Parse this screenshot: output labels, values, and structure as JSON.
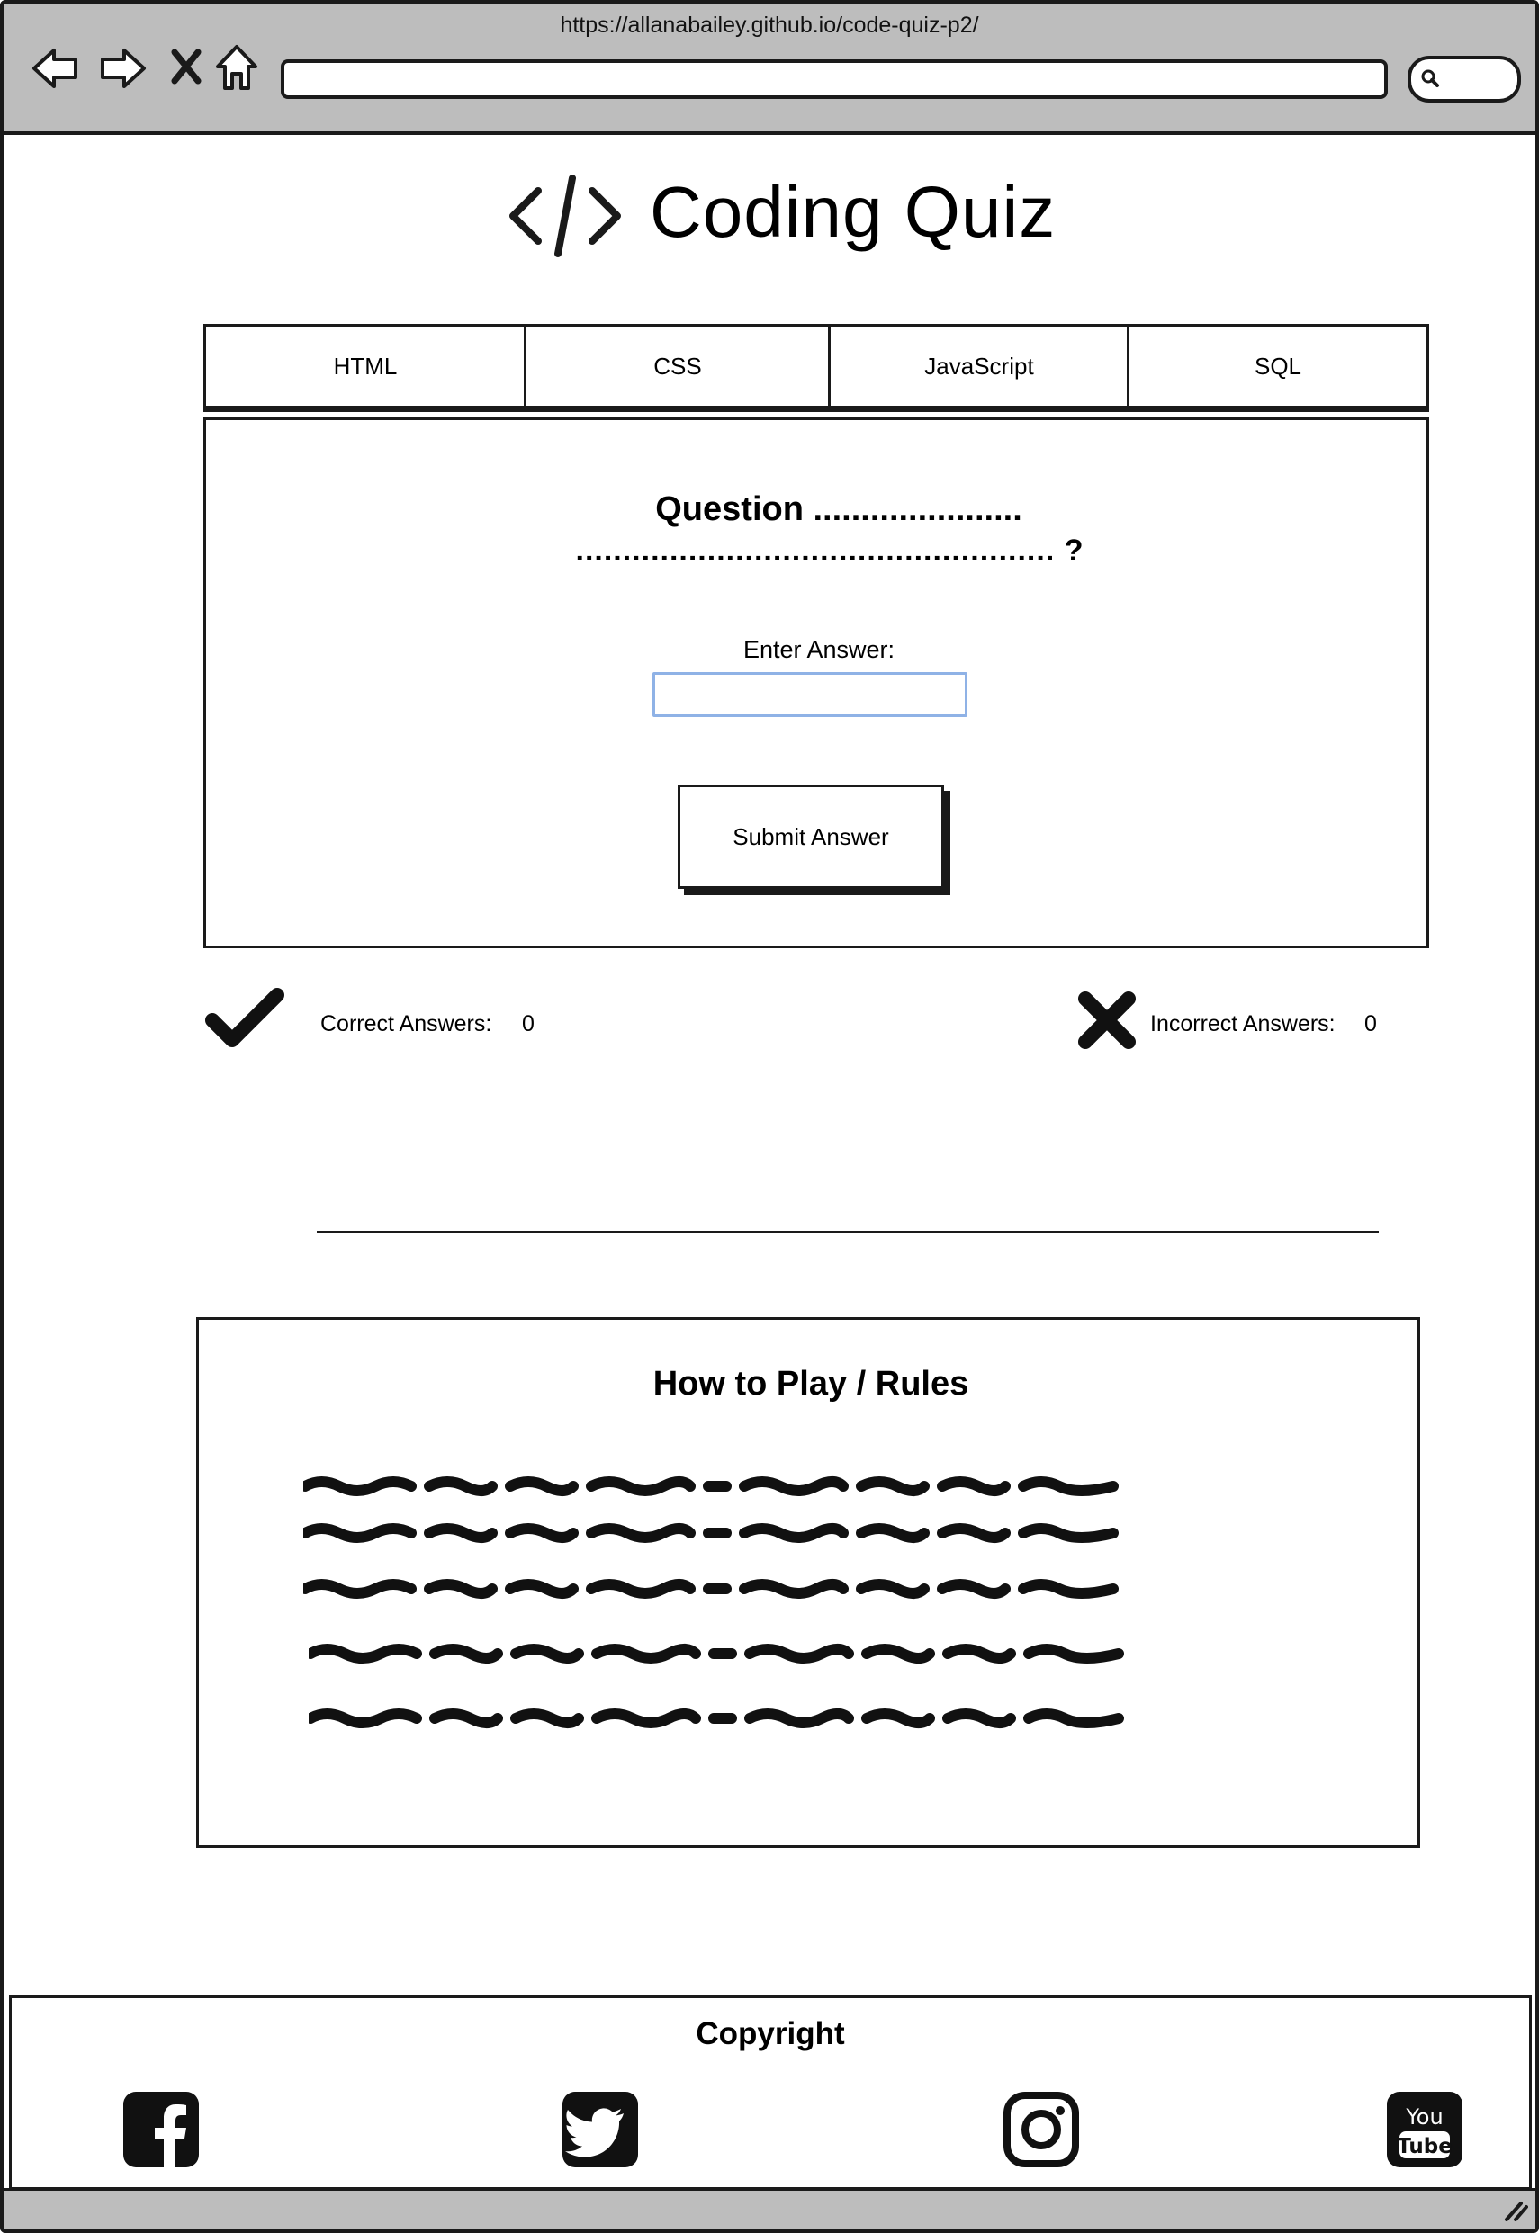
{
  "browser": {
    "url": "https://allanabailey.github.io/code-quiz-p2/",
    "icons": [
      "back-arrow-icon",
      "forward-arrow-icon",
      "close-icon",
      "home-icon",
      "search-icon"
    ]
  },
  "header": {
    "logo_icon": "code-brackets-icon",
    "title": "Coding Quiz"
  },
  "tabs": [
    {
      "label": "HTML"
    },
    {
      "label": "CSS"
    },
    {
      "label": "JavaScript"
    },
    {
      "label": "SQL"
    }
  ],
  "quiz": {
    "question_line1": "Question ......................",
    "question_line2": "................................................... ?",
    "answer_label": "Enter Answer:",
    "answer_value": "",
    "submit_label": "Submit Answer"
  },
  "score": {
    "correct_label": "Correct Answers:",
    "correct_value": "0",
    "incorrect_label": "Incorrect Answers:",
    "incorrect_value": "0"
  },
  "rules": {
    "title": "How to Play / Rules",
    "line_count": 5
  },
  "footer": {
    "copyright": "Copyright",
    "social_icons": [
      "facebook-icon",
      "twitter-icon",
      "instagram-icon",
      "youtube-icon"
    ]
  },
  "colors": {
    "chrome": "#bdbdbd",
    "outline": "#1a1a1a",
    "input_border": "#8fb2e6"
  }
}
